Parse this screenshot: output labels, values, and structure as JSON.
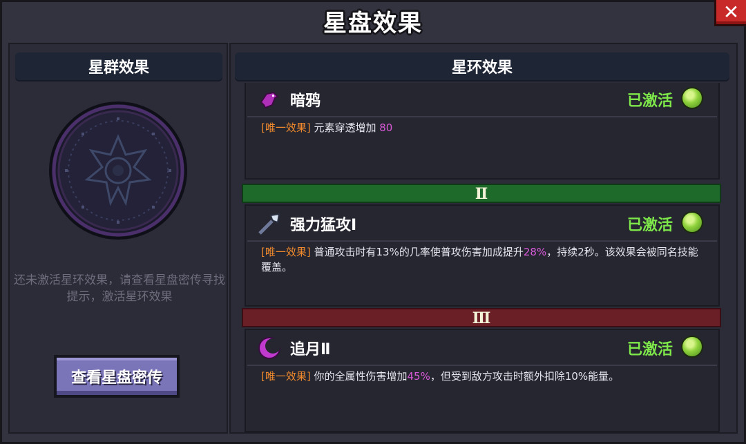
{
  "window": {
    "title": "星盘效果",
    "close_label": "✕"
  },
  "left": {
    "header": "星群效果",
    "hint": "还未激活星环效果，请查看星盘密传寻找提示，激活星环效果",
    "button_label": "查看星盘密传"
  },
  "right": {
    "header": "星环效果",
    "tiers": [
      "Ⅱ",
      "Ⅲ"
    ],
    "effects": [
      {
        "name": "暗鸦",
        "icon": "crow-icon",
        "status": "已激活",
        "tag": "[唯一效果]",
        "desc_parts": [
          " 元素穿透增加 ",
          "80",
          ""
        ]
      },
      {
        "name": "强力猛攻Ⅰ",
        "icon": "axe-icon",
        "status": "已激活",
        "tag": "[唯一效果]",
        "desc_parts": [
          " 普通攻击时有13%的几率使普攻伤害加成提升",
          "28%",
          "，持续2秒。该效果会被同名技能覆盖。"
        ]
      },
      {
        "name": "追月Ⅱ",
        "icon": "crescent-moon-icon",
        "status": "已激活",
        "tag": "[唯一效果]",
        "desc_parts": [
          " 你的全属性伤害增加",
          "45%",
          "，但受到敌方攻击时额外扣除10%能量。"
        ]
      }
    ]
  },
  "colors": {
    "active_green": "#7ee84a",
    "tag_orange": "#f08a2c",
    "highlight_purple": "#d95ad9",
    "tier2_green": "#1d6a2a",
    "tier3_red": "#6a1e26"
  }
}
